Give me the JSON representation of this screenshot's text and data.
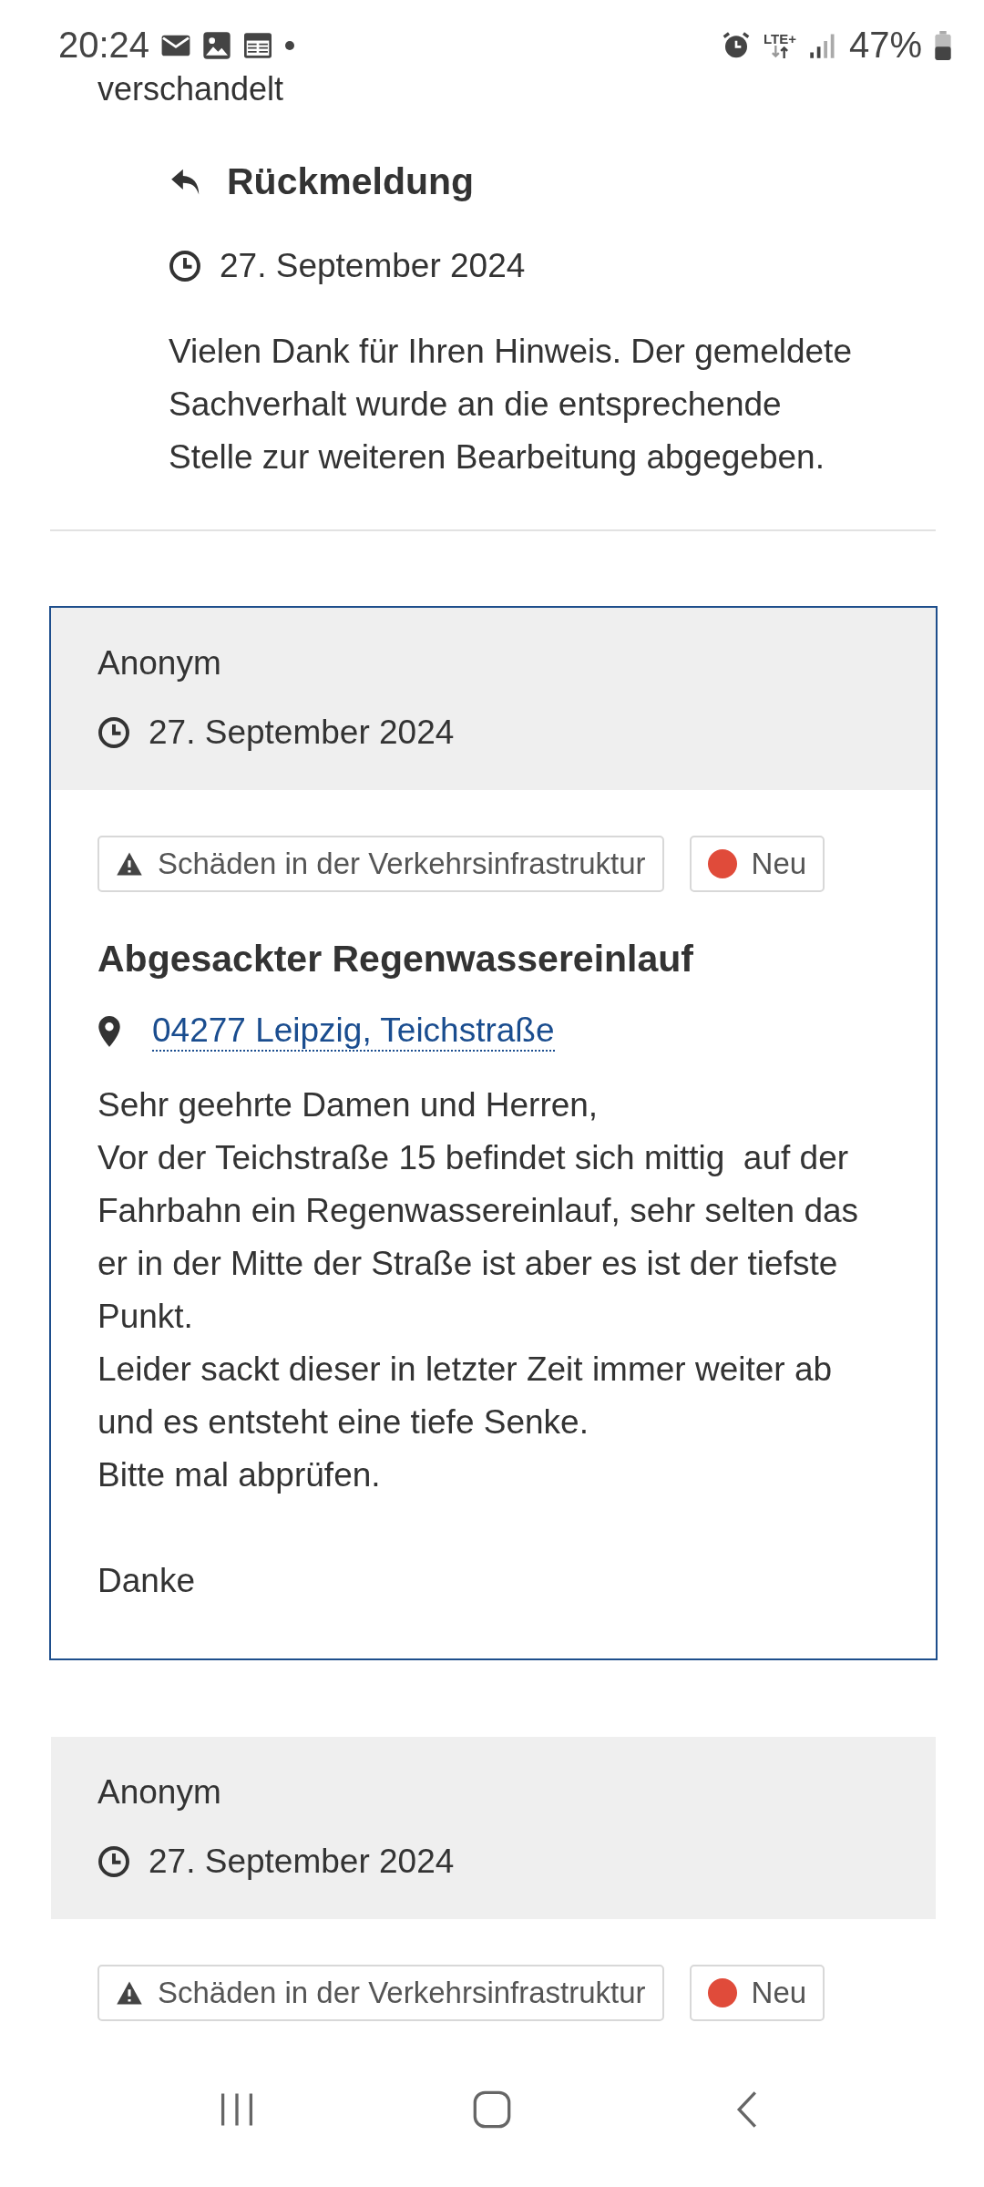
{
  "status_bar": {
    "time": "20:24",
    "network": "LTE+",
    "battery": "47%"
  },
  "previous_tail": "verschandelt",
  "response": {
    "title": "Rückmeldung",
    "date": "27. September 2024",
    "text": "Vielen Dank für Ihren Hinweis. Der gemeldete Sachverhalt wurde an die entsprechende Stelle zur weiteren Bearbeitung abgegeben."
  },
  "reports": [
    {
      "selected": true,
      "author": "Anonym",
      "date": "27. September 2024",
      "category": "Schäden in der Verkehrsinfrastruktur",
      "status": {
        "label": "Neu",
        "color": "#e04b3a"
      },
      "title": "Abgesackter Regenwassereinlauf",
      "location": "04277 Leipzig, Teichstraße",
      "text": "Sehr geehrte Damen und Herren,\nVor der Teichstraße 15 befindet sich mittig  auf der Fahrbahn ein Regenwassereinlauf, sehr selten das er in der Mitte der Straße ist aber es ist der tiefste Punkt.\nLeider sackt dieser in letzter Zeit immer weiter ab und es entsteht eine tiefe Senke.\nBitte mal abprüfen.\n\nDanke"
    },
    {
      "selected": false,
      "author": "Anonym",
      "date": "27. September 2024",
      "category": "Schäden in der Verkehrsinfrastruktur",
      "status": {
        "label": "Neu",
        "color": "#e04b3a"
      }
    }
  ]
}
